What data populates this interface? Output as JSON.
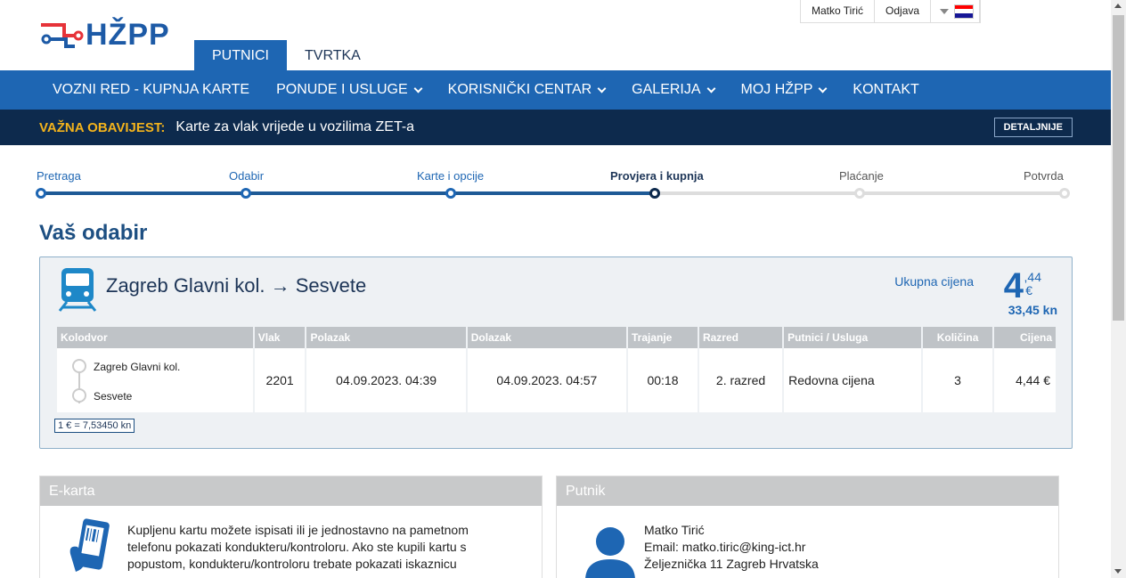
{
  "header": {
    "logo_text": "HŽPP",
    "tabs": [
      {
        "label": "PUTNICI",
        "active": true
      },
      {
        "label": "TVRTKA",
        "active": false
      }
    ],
    "user_name": "Matko Tirić",
    "logout_label": "Odjava",
    "language_icon": "croatian-flag-icon"
  },
  "nav": {
    "items": [
      {
        "label": "VOZNI RED - KUPNJA KARTE",
        "dropdown": false
      },
      {
        "label": "PONUDE I USLUGE",
        "dropdown": true
      },
      {
        "label": "KORISNIČKI CENTAR",
        "dropdown": true
      },
      {
        "label": "GALERIJA",
        "dropdown": true
      },
      {
        "label": "MOJ HŽPP",
        "dropdown": true
      },
      {
        "label": "KONTAKT",
        "dropdown": false
      }
    ]
  },
  "notice": {
    "label": "VAŽNA OBAVIJEST:",
    "text": "Karte za vlak vrijede u vozilima ZET-a",
    "button": "DETALJNIJE"
  },
  "steps": [
    {
      "label": "Pretraga",
      "state": "done"
    },
    {
      "label": "Odabir",
      "state": "done"
    },
    {
      "label": "Karte i opcije",
      "state": "done"
    },
    {
      "label": "Provjera i kupnja",
      "state": "current"
    },
    {
      "label": "Plaćanje",
      "state": "todo"
    },
    {
      "label": "Potvrda",
      "state": "todo"
    }
  ],
  "page_title": "Vaš odabir",
  "selection": {
    "route": "Zagreb Glavni kol. → Sesvete",
    "total_label": "Ukupna cijena",
    "total_int": "4",
    "total_dec": ",44",
    "total_currency": "€",
    "total_kn": "33,45 kn",
    "columns": [
      "Kolodvor",
      "Vlak",
      "Polazak",
      "Dolazak",
      "Trajanje",
      "Razred",
      "Putnici / Usluga",
      "Količina",
      "Cijena"
    ],
    "row": {
      "from_station": "Zagreb Glavni kol.",
      "to_station": "Sesvete",
      "train": "2201",
      "departure": "04.09.2023. 04:39",
      "arrival": "04.09.2023. 04:57",
      "duration": "00:18",
      "class": "2. razred",
      "passenger_type": "Redovna cijena",
      "quantity": "3",
      "price": "4,44 €"
    },
    "exchange_rate": "1 € = 7,53450 kn"
  },
  "eticket": {
    "title": "E-karta",
    "lines": [
      "Kupljenu kartu možete ispisati ili je jednostavno na pametnom",
      "telefonu pokazati kondukteru/kontroloru. Ako ste kupili kartu s",
      "popustom, kondukteru/kontroloru trebate pokazati iskaznicu"
    ]
  },
  "passenger": {
    "title": "Putnik",
    "name": "Matko Tirić",
    "email": "Email: matko.tiric@king-ict.hr",
    "address": "Željeznička 11 Zagreb Hrvatska"
  },
  "colors": {
    "primary": "#1e66b3",
    "dark": "#0d2a4d",
    "notice_label": "#f3b31c",
    "flag": [
      "#ff0000",
      "#ffffff",
      "#171796"
    ]
  }
}
